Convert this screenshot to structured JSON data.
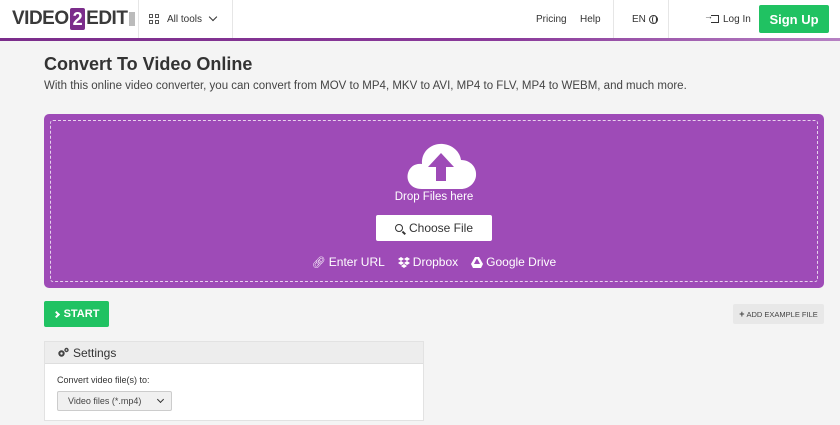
{
  "header": {
    "logo": {
      "part1": "VIDEO",
      "part2": "2",
      "part3": "EDIT"
    },
    "all_tools_label": "All tools",
    "nav": {
      "pricing": "Pricing",
      "help": "Help",
      "language": "EN",
      "login": "Log In",
      "signup": "Sign Up"
    }
  },
  "main": {
    "title": "Convert To Video Online",
    "subtitle": "With this online video converter, you can convert from MOV to MP4, MKV to AVI, MP4 to FLV, MP4 to WEBM, and much more."
  },
  "dropzone": {
    "drop_text": "Drop Files here",
    "choose_file": "Choose File",
    "sources": {
      "url": "Enter URL",
      "dropbox": "Dropbox",
      "gdrive": "Google Drive"
    }
  },
  "actions": {
    "start": "START",
    "add_example": "ADD EXAMPLE FILE"
  },
  "settings": {
    "header": "Settings",
    "label": "Convert video file(s) to:",
    "selected": "Video files (*.mp4)"
  },
  "colors": {
    "brand_purple": "#7b2d8b",
    "dropzone": "#9e4bb7",
    "green": "#20c262"
  }
}
